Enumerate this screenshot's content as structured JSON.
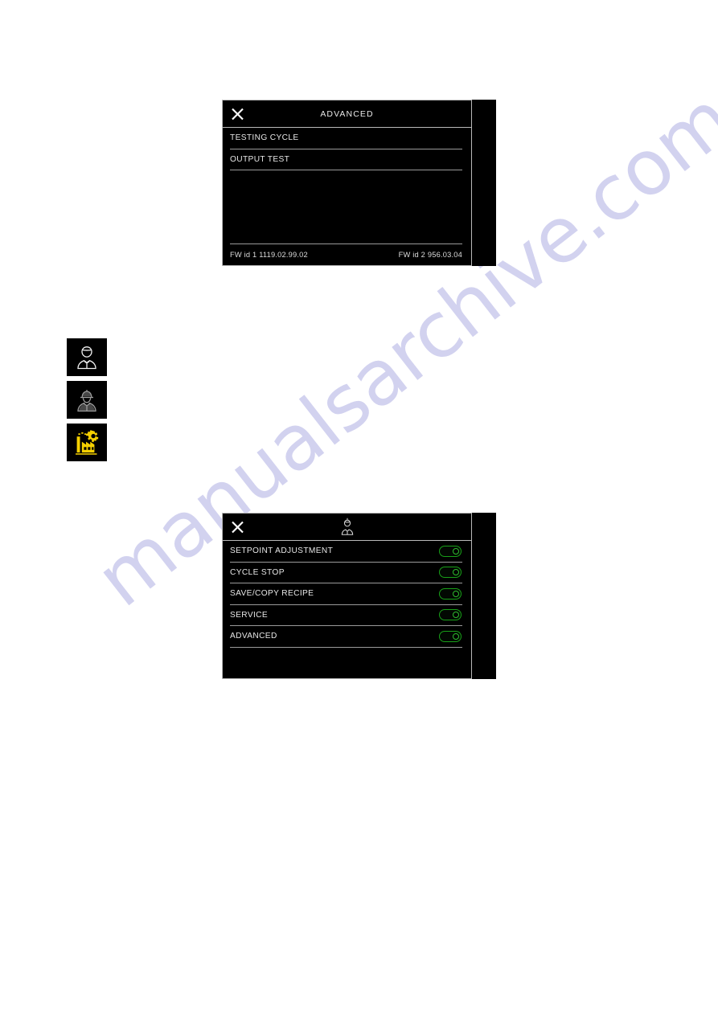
{
  "page": {
    "watermark": "manualsarchive.com",
    "background_color": "#ffffff"
  },
  "colors": {
    "panel_background": "#000000",
    "panel_border": "#b9b9b9",
    "text": "#e6e6e6",
    "toggle_on": "#18a018",
    "factory_icon": "#f5d000",
    "operator_icon": "#ffffff",
    "maintenance_icon": "#9a9a9a"
  },
  "advanced_panel": {
    "close_icon": "close-icon",
    "title": "ADVANCED",
    "rows": [
      {
        "label": "TESTING CYCLE"
      },
      {
        "label": "OUTPUT TEST"
      }
    ],
    "footer": {
      "left": "FW id 1 1119.02.99.02",
      "right": "FW id 2 956.03.04"
    }
  },
  "access_icons": [
    {
      "name": "operator-icon",
      "title": "operator"
    },
    {
      "name": "maintenance-worker-icon",
      "title": "maintenance"
    },
    {
      "name": "factory-gear-icon",
      "title": "factory"
    }
  ],
  "permissions_panel": {
    "close_icon": "close-icon",
    "header_icon": "operator-icon",
    "rows": [
      {
        "label": "SETPOINT ADJUSTMENT",
        "toggle": "on"
      },
      {
        "label": "CYCLE STOP",
        "toggle": "on"
      },
      {
        "label": "SAVE/COPY RECIPE",
        "toggle": "on"
      },
      {
        "label": "SERVICE",
        "toggle": "on"
      },
      {
        "label": "ADVANCED",
        "toggle": "on"
      }
    ]
  }
}
